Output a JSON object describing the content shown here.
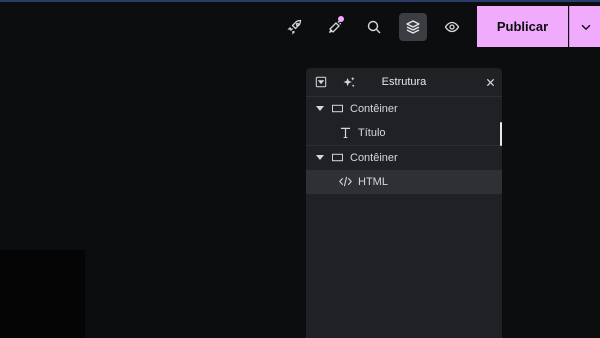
{
  "toolbar": {
    "icons": [
      "rocket-icon",
      "notifications-icon",
      "search-icon",
      "layers-icon",
      "eye-icon"
    ],
    "active_icon": "layers-icon",
    "notification_dot_color": "#f0abfc",
    "publish_label": "Publicar",
    "publish_color": "#f0abfc"
  },
  "structure_panel": {
    "title": "Estrutura",
    "items": [
      {
        "label": "Contêiner",
        "type": "container",
        "level": 0,
        "expanded": true
      },
      {
        "label": "Título",
        "type": "heading",
        "level": 1
      },
      {
        "label": "Contêiner",
        "type": "container",
        "level": 0,
        "expanded": true
      },
      {
        "label": "HTML",
        "type": "html",
        "level": 1,
        "selected": true
      }
    ]
  }
}
